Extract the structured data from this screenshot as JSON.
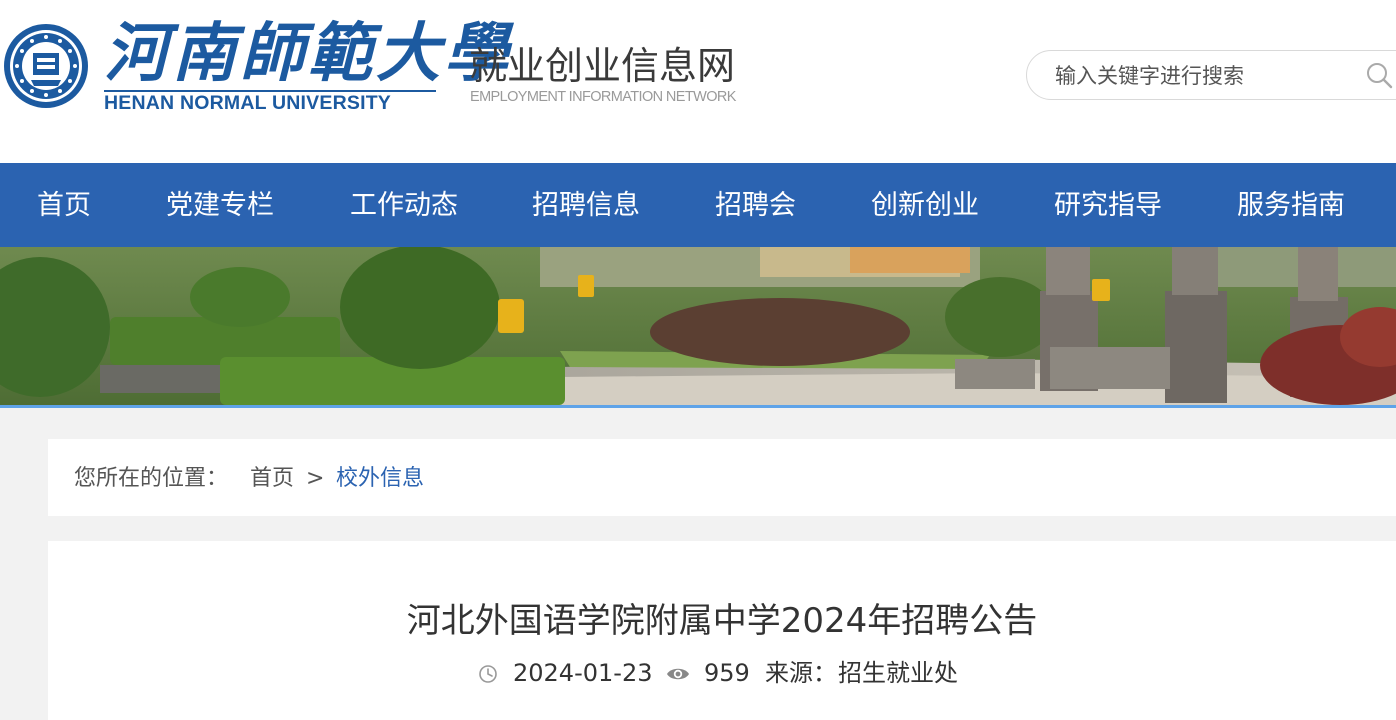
{
  "header": {
    "logo_cn": "河南師範大學",
    "logo_en": "HENAN NORMAL UNIVERSITY",
    "site_title": "就业创业信息网",
    "site_subtitle": "EMPLOYMENT INFORMATION NETWORK",
    "search": {
      "placeholder": "输入关键字进行搜索",
      "icon": "search-icon"
    }
  },
  "nav": {
    "items": [
      {
        "label": "首页"
      },
      {
        "label": "党建专栏"
      },
      {
        "label": "工作动态"
      },
      {
        "label": "招聘信息"
      },
      {
        "label": "招聘会"
      },
      {
        "label": "创新创业"
      },
      {
        "label": "研究指导"
      },
      {
        "label": "服务指南"
      }
    ]
  },
  "breadcrumb": {
    "prefix": "您所在的位置：",
    "home": "首页",
    "separator": ">",
    "current": "校外信息"
  },
  "article": {
    "title": "河北外国语学院附属中学2024年招聘公告",
    "date": "2024-01-23",
    "views": "959",
    "source_label": "来源：",
    "source": "招生就业处"
  },
  "colors": {
    "nav_bg": "#2b63b1",
    "brand_blue": "#1c5aa0",
    "breadcrumb_link": "#2b63b1",
    "page_bg": "#f2f2f2"
  }
}
